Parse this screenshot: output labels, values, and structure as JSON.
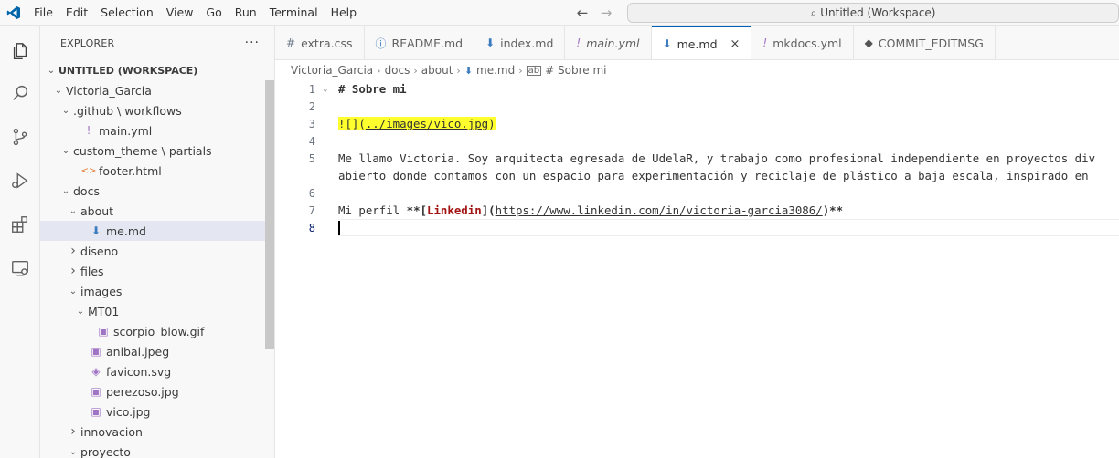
{
  "menu": [
    "File",
    "Edit",
    "Selection",
    "View",
    "Go",
    "Run",
    "Terminal",
    "Help"
  ],
  "title": "Untitled (Workspace)",
  "explorer": {
    "header": "EXPLORER",
    "more": "···",
    "tree": [
      {
        "label": "UNTITLED (WORKSPACE)",
        "depth": 0,
        "chev": "down",
        "icon": "",
        "bold": true
      },
      {
        "label": "Victoria_Garcia",
        "depth": 1,
        "chev": "down",
        "icon": ""
      },
      {
        "label": ".github \\ workflows",
        "depth": 2,
        "chev": "down",
        "icon": ""
      },
      {
        "label": "main.yml",
        "depth": 3,
        "chev": "",
        "icon": "yml"
      },
      {
        "label": "custom_theme \\ partials",
        "depth": 2,
        "chev": "down",
        "icon": ""
      },
      {
        "label": "footer.html",
        "depth": 3,
        "chev": "",
        "icon": "html"
      },
      {
        "label": "docs",
        "depth": 2,
        "chev": "down",
        "icon": ""
      },
      {
        "label": "about",
        "depth": 3,
        "chev": "down",
        "icon": ""
      },
      {
        "label": "me.md",
        "depth": 4,
        "chev": "",
        "icon": "md",
        "selected": true
      },
      {
        "label": "diseno",
        "depth": 3,
        "chev": "right",
        "icon": ""
      },
      {
        "label": "files",
        "depth": 3,
        "chev": "right",
        "icon": ""
      },
      {
        "label": "images",
        "depth": 3,
        "chev": "down",
        "icon": ""
      },
      {
        "label": "MT01",
        "depth": 4,
        "chev": "down",
        "icon": ""
      },
      {
        "label": "scorpio_blow.gif",
        "depth": 5,
        "chev": "",
        "icon": "img"
      },
      {
        "label": "anibal.jpeg",
        "depth": 4,
        "chev": "",
        "icon": "img"
      },
      {
        "label": "favicon.svg",
        "depth": 4,
        "chev": "",
        "icon": "svg"
      },
      {
        "label": "perezoso.jpg",
        "depth": 4,
        "chev": "",
        "icon": "img"
      },
      {
        "label": "vico.jpg",
        "depth": 4,
        "chev": "",
        "icon": "img"
      },
      {
        "label": "innovacion",
        "depth": 3,
        "chev": "right",
        "icon": ""
      },
      {
        "label": "proyecto",
        "depth": 3,
        "chev": "down",
        "icon": ""
      }
    ]
  },
  "tabs": [
    {
      "label": "extra.css",
      "icon": "#",
      "color": "#6c7a89"
    },
    {
      "label": "README.md",
      "icon": "ⓘ",
      "color": "#3b7bbf"
    },
    {
      "label": "index.md",
      "icon": "⬇",
      "color": "#3b7bbf"
    },
    {
      "label": "main.yml",
      "icon": "!",
      "color": "#a074c4",
      "italic": true
    },
    {
      "label": "me.md",
      "icon": "⬇",
      "color": "#3b7bbf",
      "active": true,
      "close": "×"
    },
    {
      "label": "mkdocs.yml",
      "icon": "!",
      "color": "#a074c4"
    },
    {
      "label": "COMMIT_EDITMSG",
      "icon": "◆",
      "color": "#555"
    }
  ],
  "breadcrumb": [
    "Victoria_Garcia",
    "docs",
    "about",
    "me.md",
    "# Sobre mi"
  ],
  "editor": {
    "lines": [
      {
        "n": "1",
        "text": "# Sobre mi"
      },
      {
        "n": "2",
        "text": ""
      },
      {
        "n": "3",
        "img_prefix": "![](",
        "img_path": "../images/vico.jpg",
        "img_suffix": ")"
      },
      {
        "n": "4",
        "text": ""
      },
      {
        "n": "5",
        "text": "Me llamo Victoria. Soy arquitecta egresada de UdelaR, y trabajo como profesional independiente en proyectos div"
      },
      {
        "n": "",
        "text": "abierto donde contamos con un espacio para experimentación y reciclaje de plástico a baja escala, inspirado en"
      },
      {
        "n": "6",
        "text": ""
      },
      {
        "n": "7",
        "pre": "Mi perfil ",
        "bold_open": "**[",
        "link_text": "Linkedin",
        "mid": "](",
        "url": "https://www.linkedin.com/in/victoria-garcia3086/",
        "end": ")**"
      },
      {
        "n": "8",
        "text": ""
      }
    ]
  },
  "colors": {
    "accent": "#005fb8",
    "highlight": "#ffff2e",
    "vscode_blue": "#0065a9"
  }
}
